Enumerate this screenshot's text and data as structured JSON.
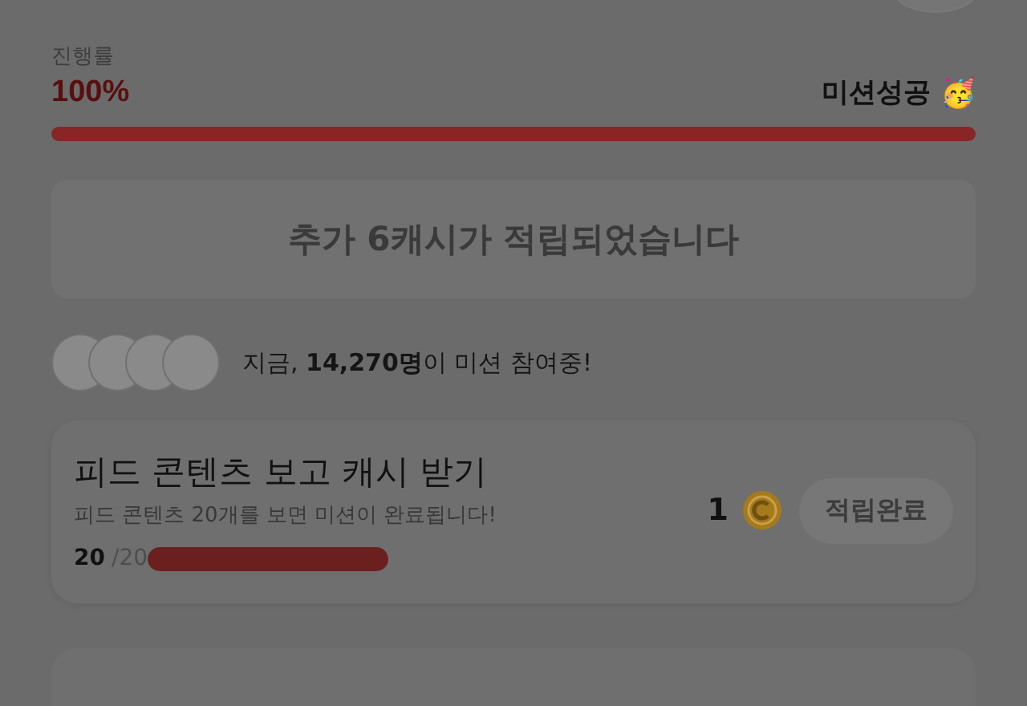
{
  "progress": {
    "label": "진행률",
    "percent": "100%",
    "level": 1,
    "status": "미션성공",
    "status_emoji": "🥳"
  },
  "notice": "추가 6캐시가 적립되었습니다",
  "participants": {
    "text": "지금, **14,270명**이 미션 참여중!"
  },
  "missions": [
    {
      "title": "피드 콘텐츠 보고 캐시 받기",
      "description": "피드 콘텐츠 20개를 보면 미션이 완료됩니다!",
      "done": "20",
      "total": "/20",
      "level": 1,
      "reward": "1",
      "button": "적립완료",
      "completed": true
    }
  ]
}
